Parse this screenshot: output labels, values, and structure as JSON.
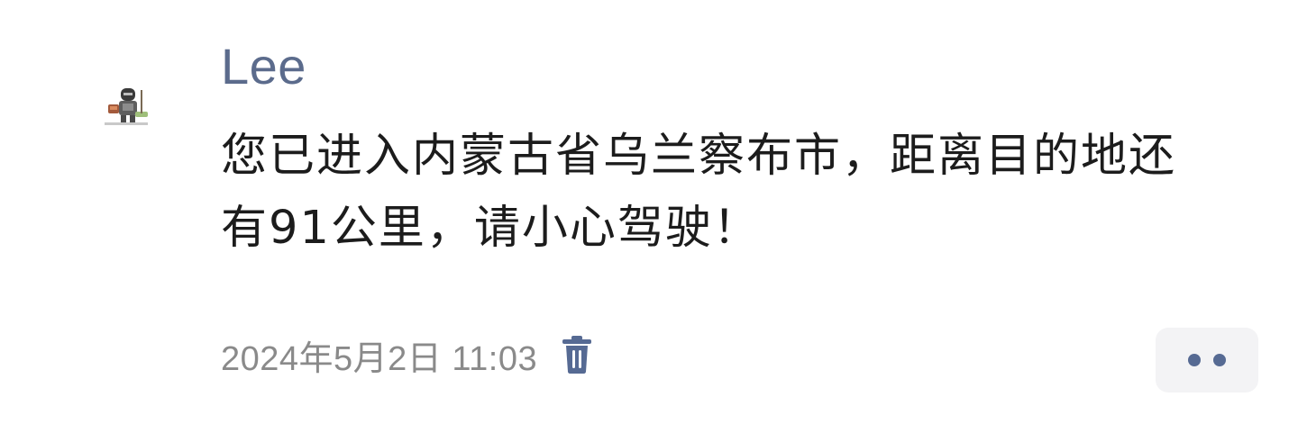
{
  "post": {
    "author": "Lee",
    "message": "您已进入内蒙古省乌兰察布市，距离目的地还有91公里，请小心驾驶！",
    "timestamp": "2024年5月2日 11:03",
    "icons": {
      "avatar": "knight-avatar-icon",
      "delete": "trash-icon",
      "more": "more-dots-icon"
    }
  },
  "colors": {
    "author": "#5b6b8c",
    "message": "#1c1c1c",
    "timestamp": "#8a8a8a",
    "accent": "#566a93",
    "more_bg": "#f3f3f5"
  }
}
